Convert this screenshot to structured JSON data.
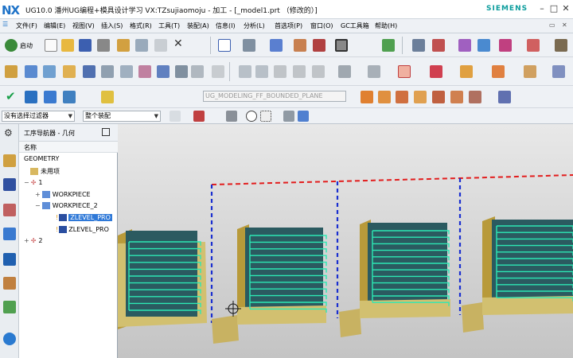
{
  "app": {
    "logo": "NX",
    "title": "UG10.0 潘州UG编程+模具设计学习 VX:TZsujiaomoju - 加工 - [_model1.prt （修改的）]",
    "brand": "SIEMENS"
  },
  "window": {
    "min": "–",
    "max": "□",
    "close": "✕"
  },
  "menu": [
    "文件(F)",
    "编辑(E)",
    "视图(V)",
    "插入(S)",
    "格式(R)",
    "工具(T)",
    "装配(A)",
    "信息(I)",
    "分析(L)",
    "首选项(P)",
    "窗口(O)",
    "GC工具箱",
    "帮助(H)"
  ],
  "toolbar": {
    "start_label": "启动",
    "operation_field": "UG_MODELING_FF_BOUNDED_PLANE"
  },
  "selection": {
    "filter": "没有选择过滤器",
    "scope": "整个装配"
  },
  "navigator": {
    "title": "工序导航器 - 几何",
    "column": "名称",
    "nodes": [
      {
        "label": "GEOMETRY",
        "level": 0
      },
      {
        "label": "未用项",
        "level": 1
      },
      {
        "label": "1",
        "level": 1
      },
      {
        "label": "WORKPIECE",
        "level": 2
      },
      {
        "label": "WORKPIECE_2",
        "level": 2
      },
      {
        "label": "ZLEVEL_PRO",
        "level": 3,
        "selected": true
      },
      {
        "label": "ZLEVEL_PRO",
        "level": 3
      },
      {
        "label": "2",
        "level": 1
      }
    ]
  },
  "colors": {
    "accent": "#2f79d8",
    "toolpath": "#2ce8b4",
    "part": "#d2c070",
    "block": "#2b5a60",
    "link": "#1a2fd0",
    "retract": "#e21c1c"
  }
}
